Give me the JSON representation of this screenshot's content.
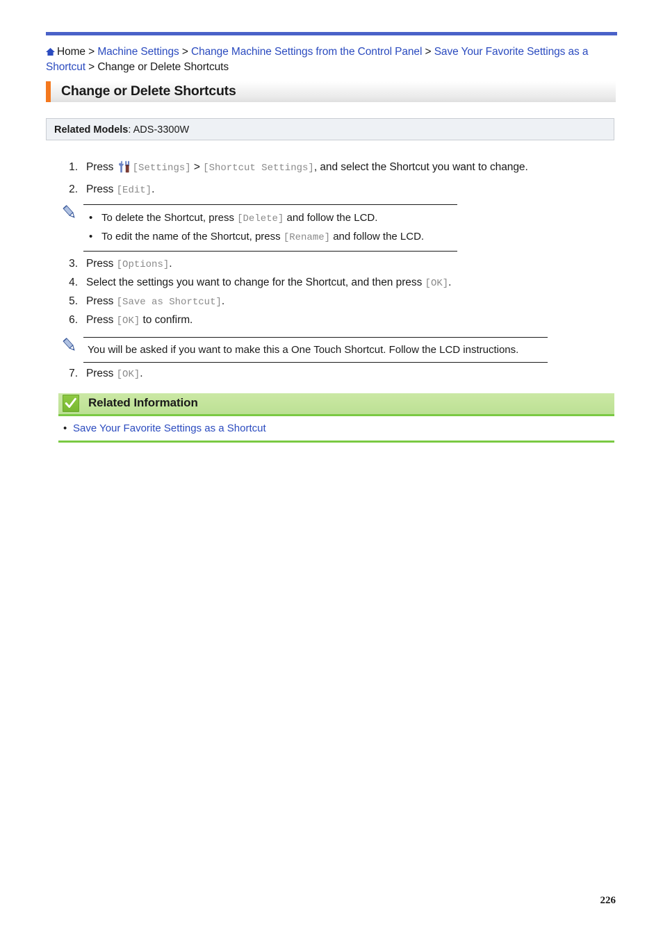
{
  "document": {
    "page_number": "226",
    "accent_colors": {
      "top_rule": "#4a62c8",
      "heading_bar": "#f4781e",
      "link": "#2b4bbf",
      "related_info_band": "#c3e49b",
      "related_info_rule": "#7ac943",
      "models_box_bg": "#eef1f5",
      "mono_text": "#8a8a8a"
    }
  },
  "breadcrumb": {
    "home_icon": "home-icon",
    "items": [
      {
        "label": "Home",
        "is_link": true
      },
      {
        "label": "Machine Settings",
        "is_link": true
      },
      {
        "label": "Change Machine Settings from the Control Panel",
        "is_link": true
      },
      {
        "label": "Save Your Favorite Settings as a Shortcut",
        "is_link": true
      },
      {
        "label": "Change or Delete Shortcuts",
        "is_link": false
      }
    ],
    "separator": ">"
  },
  "heading": {
    "title": "Change or Delete Shortcuts"
  },
  "related_models": {
    "label": "Related Models",
    "separator": ": ",
    "value": "ADS-3300W"
  },
  "steps": [
    {
      "number": "1.",
      "segments": [
        {
          "type": "text",
          "value": "Press "
        },
        {
          "type": "icon",
          "value": "settings-tools-icon"
        },
        {
          "type": "mono",
          "value": "[Settings]"
        },
        {
          "type": "text",
          "value": " > "
        },
        {
          "type": "mono",
          "value": "[Shortcut Settings]"
        },
        {
          "type": "text",
          "value": ", and select the Shortcut you want to change."
        }
      ]
    },
    {
      "number": "2.",
      "segments": [
        {
          "type": "text",
          "value": "Press "
        },
        {
          "type": "mono",
          "value": "[Edit]"
        },
        {
          "type": "text",
          "value": "."
        }
      ]
    },
    {
      "number": "3.",
      "segments": [
        {
          "type": "text",
          "value": "Press "
        },
        {
          "type": "mono",
          "value": "[Options]"
        },
        {
          "type": "text",
          "value": "."
        }
      ]
    },
    {
      "number": "4.",
      "segments": [
        {
          "type": "text",
          "value": "Select the settings you want to change for the Shortcut, and then press "
        },
        {
          "type": "mono",
          "value": "[OK]"
        },
        {
          "type": "text",
          "value": "."
        }
      ]
    },
    {
      "number": "5.",
      "segments": [
        {
          "type": "text",
          "value": "Press "
        },
        {
          "type": "mono",
          "value": "[Save as Shortcut]"
        },
        {
          "type": "text",
          "value": "."
        }
      ]
    },
    {
      "number": "6.",
      "segments": [
        {
          "type": "text",
          "value": "Press "
        },
        {
          "type": "mono",
          "value": "[OK]"
        },
        {
          "type": "text",
          "value": " to confirm."
        }
      ]
    },
    {
      "number": "7.",
      "segments": [
        {
          "type": "text",
          "value": "Press "
        },
        {
          "type": "mono",
          "value": "[OK]"
        },
        {
          "type": "text",
          "value": "."
        }
      ]
    }
  ],
  "note_one": {
    "icon": "pencil-note-icon",
    "bullet": "•",
    "items": [
      [
        {
          "type": "text",
          "value": "To delete the Shortcut, press "
        },
        {
          "type": "mono",
          "value": "[Delete]"
        },
        {
          "type": "text",
          "value": " and follow the LCD."
        }
      ],
      [
        {
          "type": "text",
          "value": "To edit the name of the Shortcut, press "
        },
        {
          "type": "mono",
          "value": "[Rename]"
        },
        {
          "type": "text",
          "value": " and follow the LCD."
        }
      ]
    ]
  },
  "note_two": {
    "icon": "pencil-note-icon",
    "text": "You will be asked if you want to make this a One Touch Shortcut. Follow the LCD instructions."
  },
  "related_information": {
    "icon": "green-check-icon",
    "title": "Related Information",
    "bullet": "•",
    "links": [
      {
        "label": "Save Your Favorite Settings as a Shortcut"
      }
    ]
  }
}
